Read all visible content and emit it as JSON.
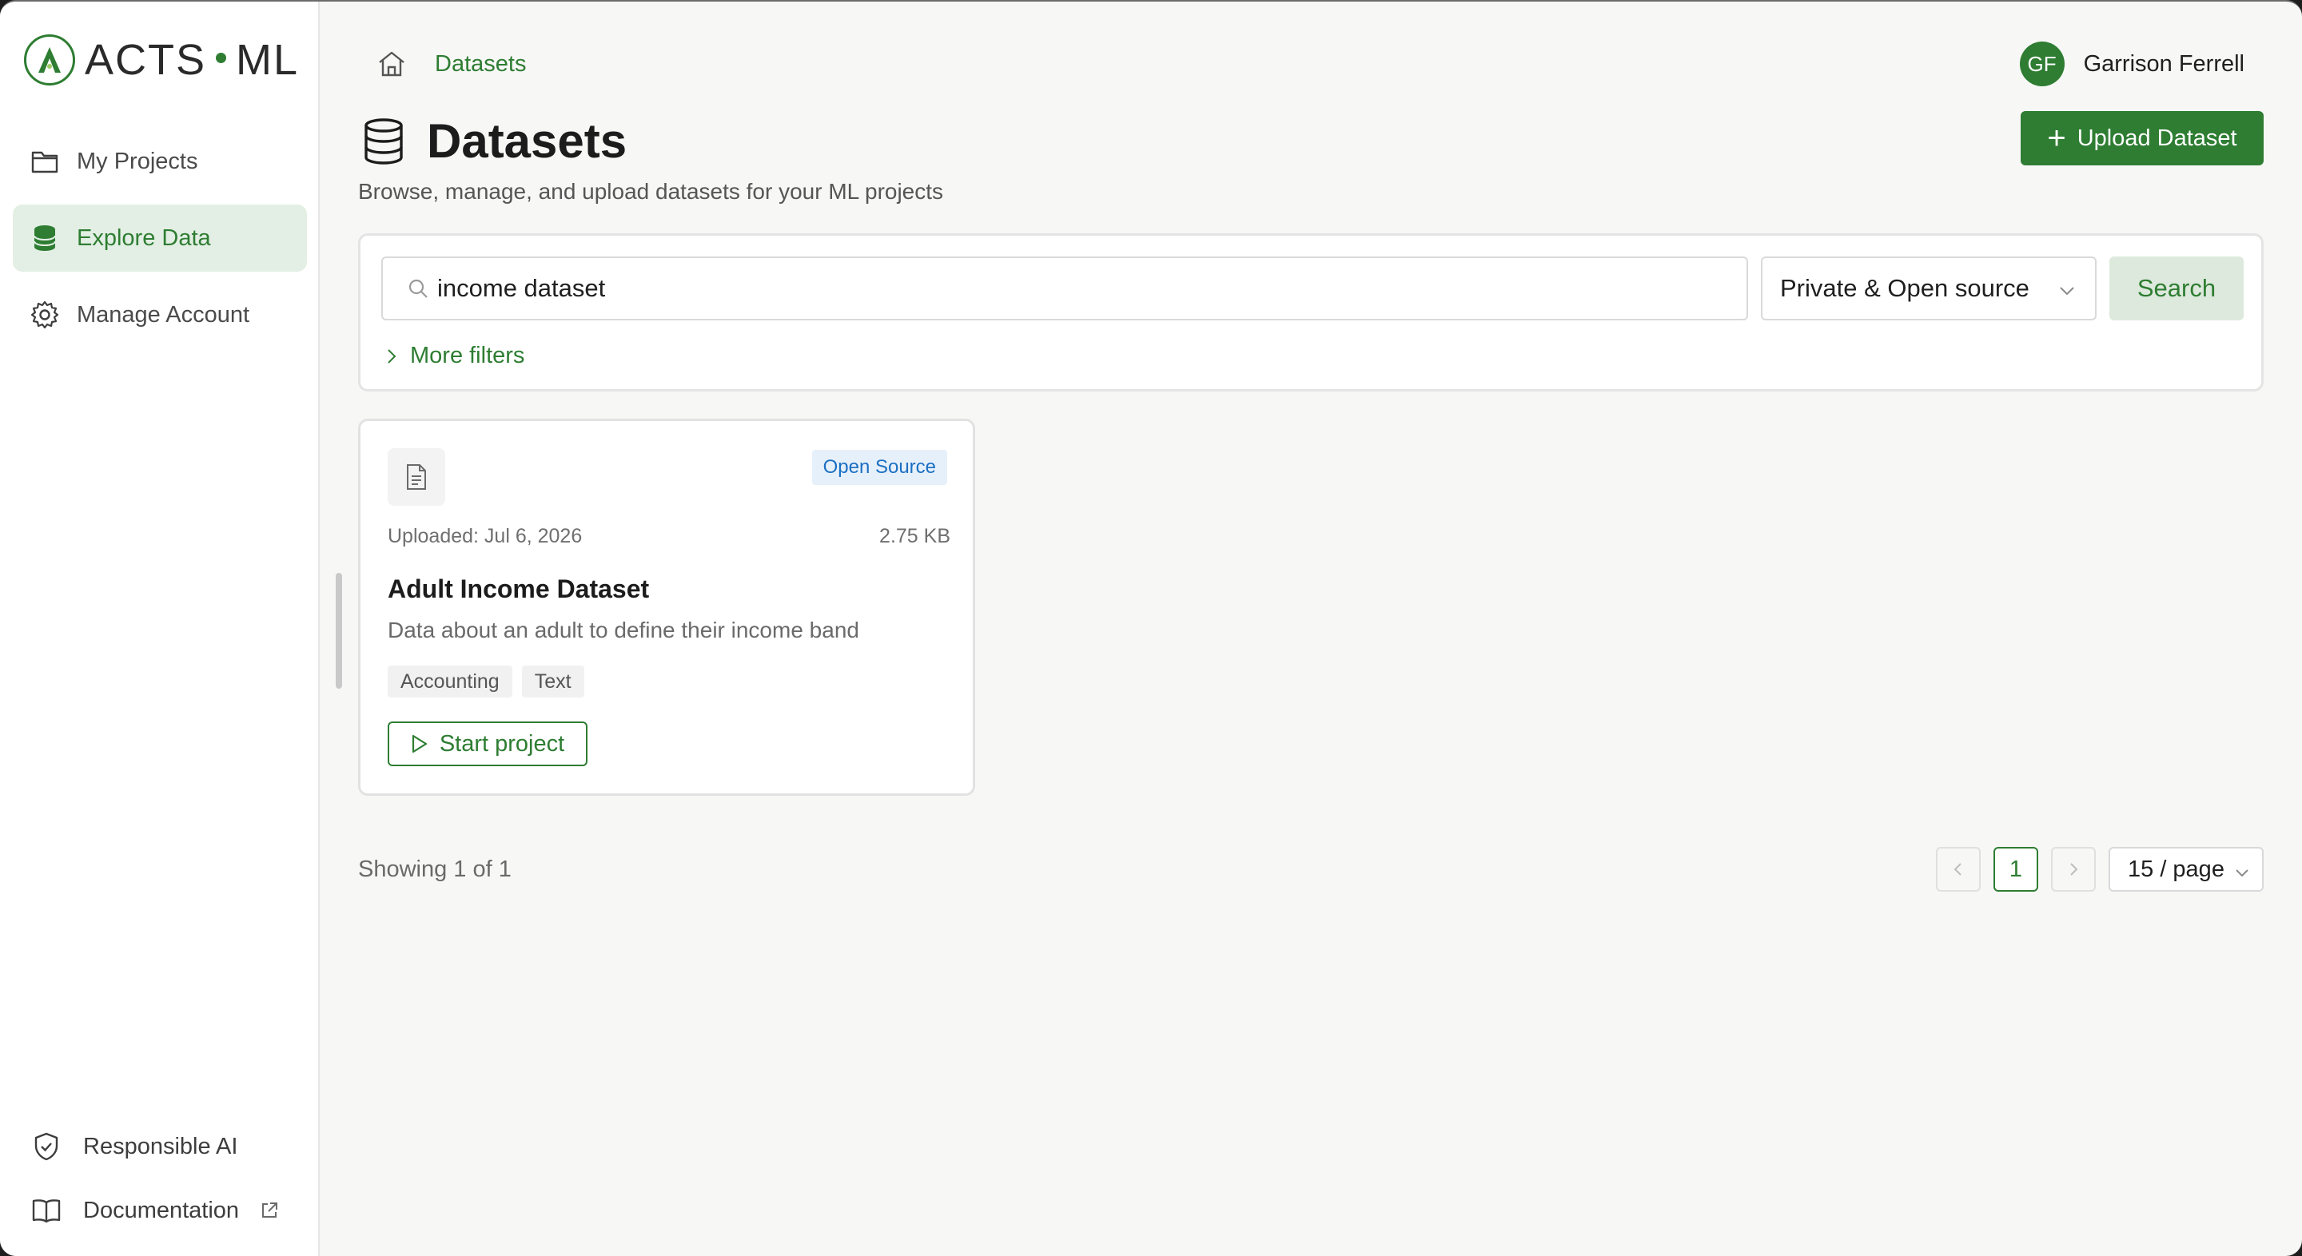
{
  "brand": {
    "name_left": "ACTS",
    "name_right": "ML"
  },
  "sidebar": {
    "items": [
      {
        "label": "My Projects",
        "icon": "folder-icon",
        "active": false
      },
      {
        "label": "Explore Data",
        "icon": "database-icon",
        "active": true
      },
      {
        "label": "Manage Account",
        "icon": "gear-icon",
        "active": false
      }
    ],
    "bottom": [
      {
        "label": "Responsible AI",
        "icon": "shield-check-icon"
      },
      {
        "label": "Documentation",
        "icon": "book-icon",
        "external": true
      }
    ]
  },
  "breadcrumb": {
    "current": "Datasets"
  },
  "user": {
    "initials": "GF",
    "name": "Garrison Ferrell"
  },
  "page": {
    "title": "Datasets",
    "subtitle": "Browse, manage, and upload datasets for your ML projects",
    "upload_label": "Upload Dataset"
  },
  "search": {
    "value": "income dataset",
    "scope": "Private & Open source",
    "button_label": "Search",
    "more_filters_label": "More filters"
  },
  "results": [
    {
      "badge": "Open Source",
      "uploaded": "Uploaded: Jul 6, 2026",
      "size": "2.75 KB",
      "title": "Adult Income Dataset",
      "description": "Data about an adult to define their income band",
      "tags": [
        "Accounting",
        "Text"
      ],
      "action_label": "Start project"
    }
  ],
  "pagination": {
    "showing": "Showing 1 of 1",
    "current_page": "1",
    "page_size": "15 / page"
  },
  "colors": {
    "accent": "#2e7d32",
    "accent_light": "#e3efe4",
    "badge_bg": "#e6f0fa",
    "badge_text": "#1b6fc2"
  }
}
